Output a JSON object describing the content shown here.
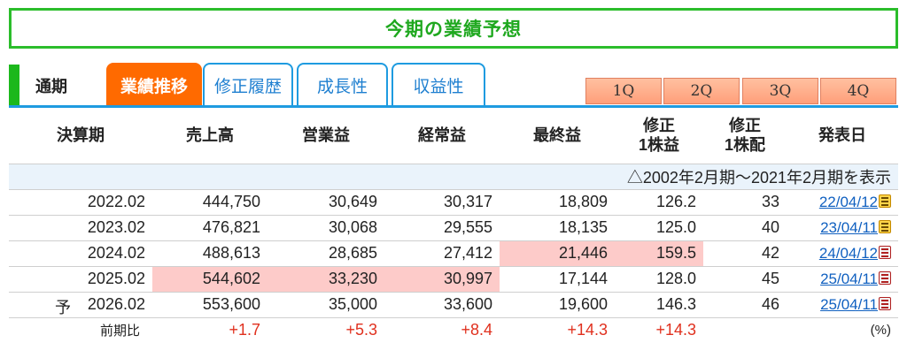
{
  "header": {
    "title": "今期の業績予想"
  },
  "tabs": {
    "period_label": "通期",
    "items": [
      {
        "label": "業績推移",
        "active": true
      },
      {
        "label": "修正履歴",
        "active": false
      },
      {
        "label": "成長性",
        "active": false
      },
      {
        "label": "収益性",
        "active": false
      }
    ],
    "quarters": [
      "1Q",
      "2Q",
      "3Q",
      "4Q"
    ]
  },
  "table": {
    "headers": {
      "period": "決算期",
      "sales": "売上高",
      "operating": "営業益",
      "ordinary": "経常益",
      "net": "最終益",
      "eps_line1": "修正",
      "eps_line2": "1株益",
      "dps_line1": "修正",
      "dps_line2": "1株配",
      "date": "発表日"
    },
    "notice": "△2002年2月期～2021年2月期を表示",
    "rows": [
      {
        "forecast_mark": "",
        "period": "2022.02",
        "sales": "444,750",
        "operating": "30,649",
        "ordinary": "30,317",
        "net": "18,809",
        "eps": "126.2",
        "dps": "33",
        "date": "22/04/12",
        "icon": "ttl-doc-icon"
      },
      {
        "forecast_mark": "",
        "period": "2023.02",
        "sales": "476,821",
        "operating": "30,068",
        "ordinary": "29,555",
        "net": "18,135",
        "eps": "125.0",
        "dps": "40",
        "date": "23/04/11",
        "icon": "ttl-doc-icon"
      },
      {
        "forecast_mark": "",
        "period": "2024.02",
        "sales": "488,613",
        "operating": "28,685",
        "ordinary": "27,412",
        "net": "21,446",
        "eps": "159.5",
        "dps": "42",
        "date": "24/04/12",
        "icon": "pdf-doc-icon"
      },
      {
        "forecast_mark": "",
        "period": "2025.02",
        "sales": "544,602",
        "operating": "33,230",
        "ordinary": "30,997",
        "net": "17,144",
        "eps": "128.0",
        "dps": "45",
        "date": "25/04/11",
        "icon": "pdf-doc-icon"
      },
      {
        "forecast_mark": "予",
        "period": "2026.02",
        "sales": "553,600",
        "operating": "35,000",
        "ordinary": "33,600",
        "net": "19,600",
        "eps": "146.3",
        "dps": "46",
        "date": "25/04/11",
        "icon": "pdf-doc-icon"
      }
    ],
    "comparison": {
      "label": "前期比",
      "sales": "+1.7",
      "operating": "+5.3",
      "ordinary": "+8.4",
      "net": "+14.3",
      "eps": "+14.3",
      "unit": "(%)"
    }
  },
  "colors": {
    "title_green": "#1fa81f",
    "tab_active": "#ff6a00",
    "tab_border": "#1e9be0",
    "highlight": "#fdcbc9",
    "positive_red": "#e0301e"
  }
}
